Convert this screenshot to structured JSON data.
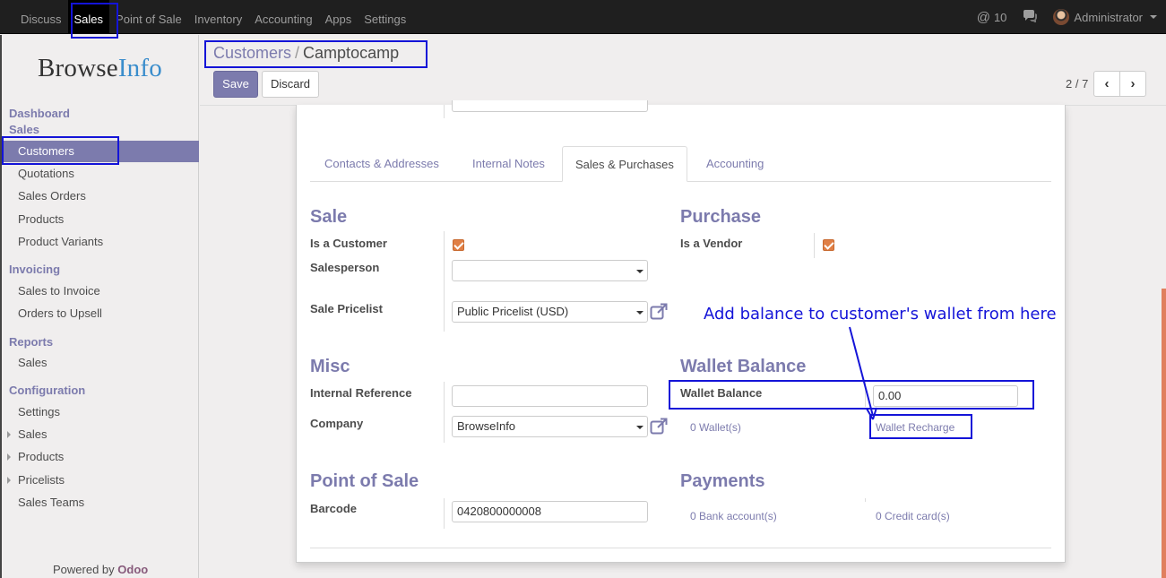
{
  "topnav": {
    "items": [
      {
        "label": "Discuss"
      },
      {
        "label": "Sales",
        "active": true
      },
      {
        "label": "Point of Sale"
      },
      {
        "label": "Inventory"
      },
      {
        "label": "Accounting"
      },
      {
        "label": "Apps"
      },
      {
        "label": "Settings"
      }
    ],
    "mentions_count": "10",
    "user_name": "Administrator"
  },
  "sidebar": {
    "logo_part1": "Browse",
    "logo_part2": "Info",
    "sections": {
      "dashboard": "Dashboard",
      "sales": "Sales",
      "invoicing": "Invoicing",
      "reports": "Reports",
      "configuration": "Configuration"
    },
    "items": {
      "customers": "Customers",
      "quotations": "Quotations",
      "sales_orders": "Sales Orders",
      "products": "Products",
      "product_variants": "Product Variants",
      "sales_to_invoice": "Sales to Invoice",
      "orders_to_upsell": "Orders to Upsell",
      "reports_sales": "Sales",
      "settings": "Settings",
      "config_sales": "Sales",
      "config_products": "Products",
      "pricelists": "Pricelists",
      "sales_teams": "Sales Teams"
    },
    "powered_by": "Powered by",
    "odoo": "Odoo"
  },
  "control_panel": {
    "breadcrumb_parent": "Customers",
    "breadcrumb_sep": "/",
    "breadcrumb_current": "Camptocamp",
    "save_label": "Save",
    "discard_label": "Discard",
    "pager_text": "2 / 7",
    "prev_icon": "‹",
    "next_icon": "›"
  },
  "tabs": {
    "contacts": "Contacts & Addresses",
    "notes": "Internal Notes",
    "sales_purchases": "Sales & Purchases",
    "accounting": "Accounting"
  },
  "form": {
    "sale_title": "Sale",
    "is_customer_label": "Is a Customer",
    "is_customer": true,
    "salesperson_label": "Salesperson",
    "salesperson_value": "",
    "sale_pricelist_label": "Sale Pricelist",
    "sale_pricelist_value": "Public Pricelist (USD)",
    "purchase_title": "Purchase",
    "is_vendor_label": "Is a Vendor",
    "is_vendor": true,
    "misc_title": "Misc",
    "internal_ref_label": "Internal Reference",
    "internal_ref_value": "",
    "company_label": "Company",
    "company_value": "BrowseInfo",
    "wallet_title": "Wallet Balance",
    "wallet_balance_label": "Wallet Balance",
    "wallet_balance_value": "0.00",
    "wallets_link": "0 Wallet(s)",
    "wallet_recharge_link": "Wallet Recharge",
    "pos_title": "Point of Sale",
    "barcode_label": "Barcode",
    "barcode_value": "0420800000008",
    "payments_title": "Payments",
    "bank_accounts_link": "0 Bank account(s)",
    "credit_cards_link": "0 Credit card(s)"
  },
  "annotation": {
    "text": "Add balance to customer's wallet from here",
    "color": "#1414d8"
  },
  "colors": {
    "accent": "#7c7bad",
    "checkbox": "#e07f45",
    "topbar": "#1f1f1f"
  }
}
